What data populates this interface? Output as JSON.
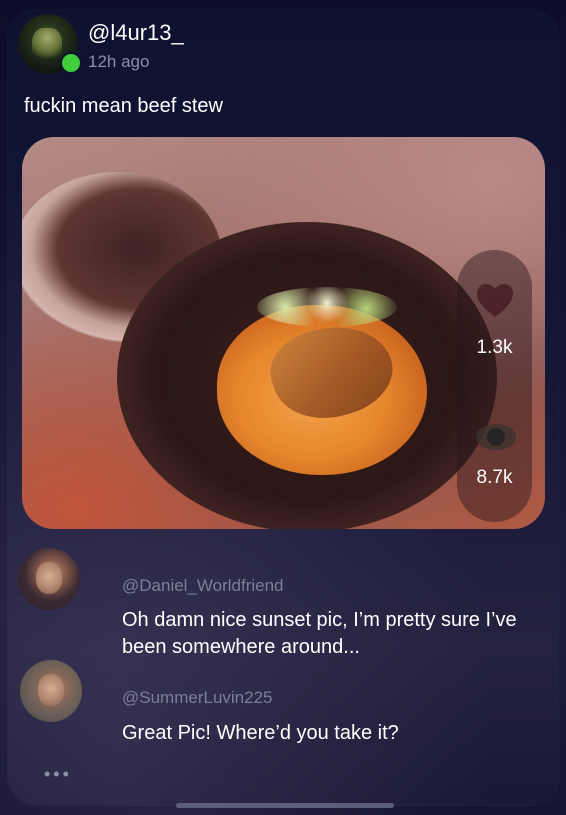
{
  "post": {
    "username": "@l4ur13_",
    "time": "12h ago",
    "caption": "fuckin mean beef stew",
    "likes": "1.3k",
    "views": "8.7k"
  },
  "comments": [
    {
      "username": "@Daniel_Worldfriend",
      "text": "Oh damn nice sunset pic, I’m pretty sure I’ve been somewhere around..."
    },
    {
      "username": "@SummerLuvin225",
      "text": "Great Pic! Where’d you take it?"
    }
  ],
  "icons": {
    "like": "heart-icon",
    "views": "eye-icon",
    "more": "more-icon"
  },
  "colors": {
    "online": "#3fcf3a",
    "background": "#0a0c24",
    "muted_text": "#8b8ea6"
  }
}
